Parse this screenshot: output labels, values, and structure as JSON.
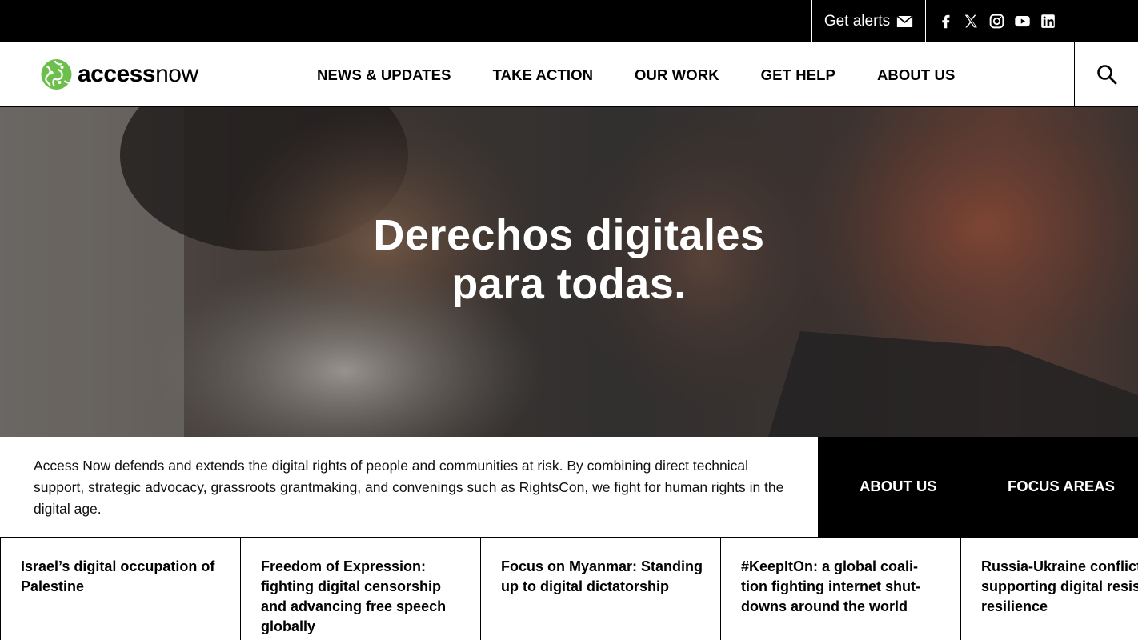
{
  "topbar": {
    "alerts_label": "Get alerts",
    "socials": [
      "facebook-icon",
      "x-icon",
      "instagram-icon",
      "youtube-icon",
      "linkedin-icon"
    ]
  },
  "header": {
    "logo_bold": "access",
    "logo_light": "now",
    "nav": [
      "NEWS & UPDATES",
      "TAKE ACTION",
      "OUR WORK",
      "GET HELP",
      "ABOUT US"
    ]
  },
  "hero": {
    "title_line1": "Derechos digitales",
    "title_line2": "para todas."
  },
  "intro": {
    "text": "Access Now defends and extends the digital rights of people and communities at risk. By combining direct technical support, strategic advocacy, grassroots grantmaking, and convenings such as RightsCon, we fight for human rights in the digital age.",
    "links": [
      "ABOUT US",
      "FOCUS AREAS"
    ]
  },
  "cards": [
    "Israel’s digital occupation of Palestine",
    "Freedom of Expression: fighting digital censorship and advancing free speech globally",
    "Focus on Myanmar: Standing up to digital dictatorship",
    "#KeepItOn: a global coali- tion fighting internet shut- downs around the world",
    "Russia-Ukraine conflict: supporting digital resis- tance and resilience"
  ],
  "colors": {
    "black": "#000000",
    "white": "#ffffff",
    "logo_green": "#6cbf4a"
  }
}
